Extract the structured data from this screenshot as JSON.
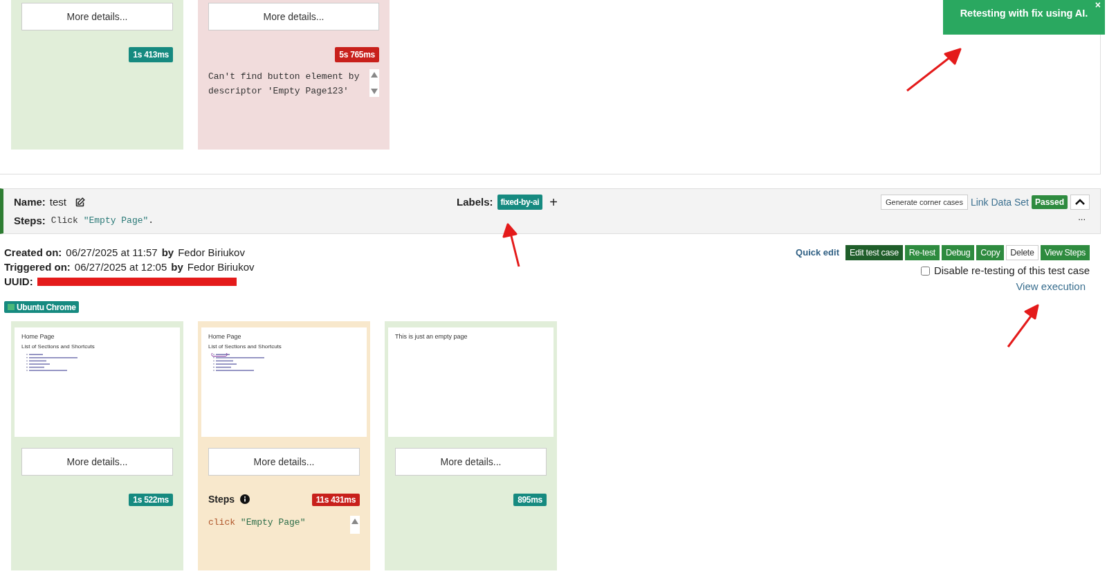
{
  "top_cards": [
    {
      "color": "#e1eed9",
      "details_button": "More details...",
      "duration": {
        "text": "1s 413ms",
        "color": "#168a80"
      }
    },
    {
      "color": "#f1dcdc",
      "details_button": "More details...",
      "duration": {
        "text": "5s 765ms",
        "color": "#c8201b"
      },
      "message": "Can't find button element by descriptor 'Empty Page123'"
    }
  ],
  "toast": {
    "text": "Retesting with fix using AI.",
    "close": "×"
  },
  "test_case": {
    "name_label": "Name:",
    "name": "test",
    "steps_label": "Steps:",
    "steps": {
      "command": "Click",
      "argument": "\"Empty Page\"",
      "suffix": "."
    },
    "labels_label": "Labels:",
    "labels": [
      {
        "text": "fixed-by-ai"
      }
    ],
    "add_label": "+",
    "generate_button": "Generate corner cases",
    "link_data_set": "Link Data Set",
    "status_badge": "Passed",
    "expanded": true,
    "more": "..."
  },
  "details": {
    "rows": [
      {
        "label": "Created on:",
        "date": "06/27/2025 at 11:57",
        "by": "by",
        "user": "Fedor Biriukov"
      },
      {
        "label": "Triggered on:",
        "date": "06/27/2025 at 12:05",
        "by": "by",
        "user": "Fedor Biriukov"
      }
    ],
    "uuid_label": "UUID:",
    "uuid_redacted": true,
    "browser": "Ubuntu Chrome"
  },
  "actions": {
    "quick_edit": "Quick edit",
    "buttons": [
      {
        "label": "Edit test case",
        "kind": "dark"
      },
      {
        "label": "Re-test",
        "kind": "green"
      },
      {
        "label": "Debug",
        "kind": "green"
      },
      {
        "label": "Copy",
        "kind": "green"
      },
      {
        "label": "Delete",
        "kind": "plain"
      },
      {
        "label": "View Steps",
        "kind": "green"
      }
    ],
    "disable_retest": {
      "label": "Disable re-testing of this test case",
      "checked": false
    },
    "view_execution": "View execution"
  },
  "screenshot_cards": [
    {
      "color": "#e1eed9",
      "preview": {
        "title": "Home Page",
        "subtitle": "List of Sections and Shortcuts",
        "highlight": false
      },
      "details_button": "More details...",
      "duration": {
        "text": "1s 522ms",
        "color": "#168a80"
      }
    },
    {
      "color": "#f8e8cc",
      "preview": {
        "title": "Home Page",
        "subtitle": "List of Sections and Shortcuts",
        "highlight": true
      },
      "details_button": "More details...",
      "steps_label": "Steps",
      "duration": {
        "text": "11s 431ms",
        "color": "#c8201b"
      },
      "code": {
        "command": "click",
        "argument": "\"Empty Page\""
      }
    },
    {
      "color": "#e1eed9",
      "preview": {
        "title": "This is just an empty page"
      },
      "details_button": "More details...",
      "duration": {
        "text": "895ms",
        "color": "#168a80"
      }
    }
  ]
}
